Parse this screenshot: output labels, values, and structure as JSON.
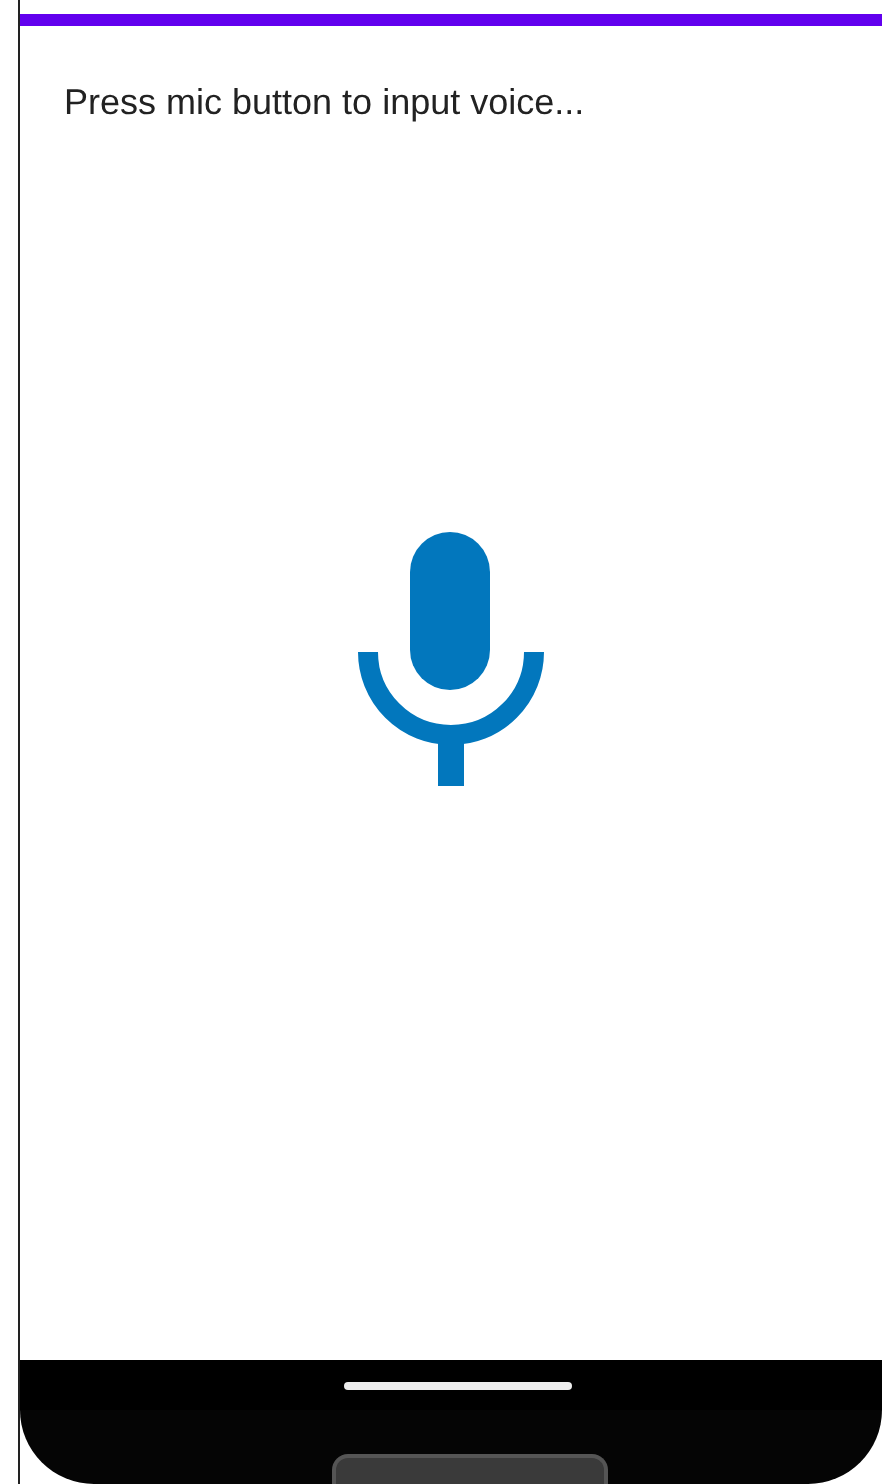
{
  "prompt": "Press mic button to input voice..."
}
